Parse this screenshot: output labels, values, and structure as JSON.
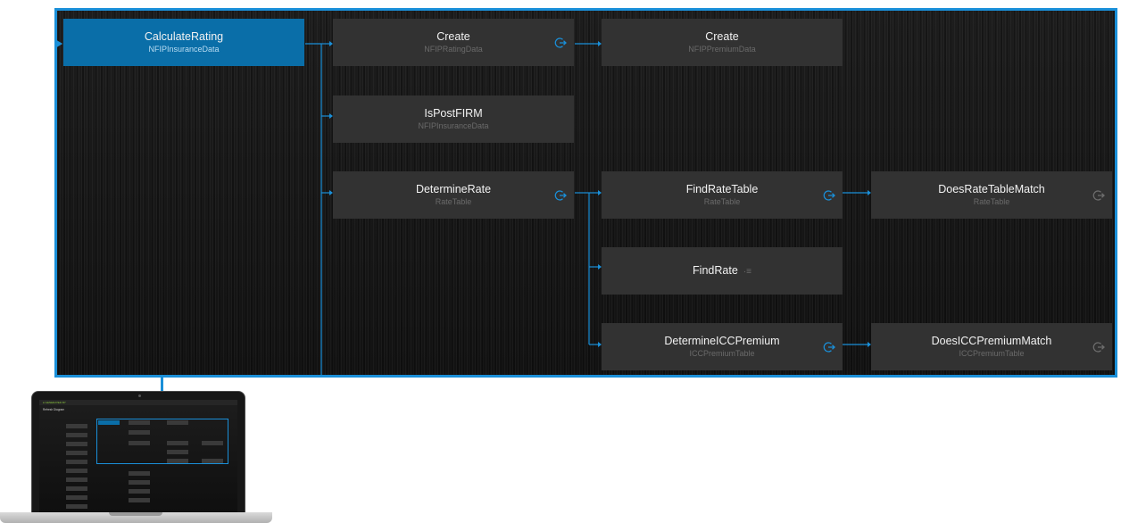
{
  "colors": {
    "accent": "#1a8fd8",
    "primary_node": "#0a6ea8",
    "node": "#323232",
    "panel_background": "#131313",
    "node_subtitle": "#6a6a6a",
    "brand_green": "#8cc63f"
  },
  "diagram": {
    "nodes": [
      {
        "id": "calculate-rating",
        "title": "CalculateRating",
        "subtitle": "NFIPInsuranceData",
        "primary": true
      },
      {
        "id": "create-rating",
        "title": "Create",
        "subtitle": "NFIPRatingData",
        "expand_icon": "enter-arrow-icon"
      },
      {
        "id": "create-premium",
        "title": "Create",
        "subtitle": "NFIPPremiumData"
      },
      {
        "id": "is-post-firm",
        "title": "IsPostFIRM",
        "subtitle": "NFIPInsuranceData"
      },
      {
        "id": "determine-rate",
        "title": "DetermineRate",
        "subtitle": "RateTable",
        "expand_icon": "enter-arrow-icon"
      },
      {
        "id": "find-rate-table",
        "title": "FindRateTable",
        "subtitle": "RateTable",
        "expand_icon": "enter-arrow-icon"
      },
      {
        "id": "does-rate-table-match",
        "title": "DoesRateTableMatch",
        "subtitle": "RateTable",
        "expand_icon": "enter-arrow-icon",
        "muted": true
      },
      {
        "id": "find-rate",
        "title": "FindRate",
        "subtitle": "",
        "list_icon": "list-icon"
      },
      {
        "id": "determine-icc-premium",
        "title": "DetermineICCPremium",
        "subtitle": "ICCPremiumTable",
        "expand_icon": "enter-arrow-icon"
      },
      {
        "id": "does-icc-premium-match",
        "title": "DoesICCPremiumMatch",
        "subtitle": "ICCPremiumTable",
        "expand_icon": "enter-arrow-icon",
        "muted": true
      }
    ],
    "edges": [
      [
        "calculate-rating",
        "create-rating"
      ],
      [
        "calculate-rating",
        "is-post-firm"
      ],
      [
        "calculate-rating",
        "determine-rate"
      ],
      [
        "create-rating",
        "create-premium"
      ],
      [
        "determine-rate",
        "find-rate-table"
      ],
      [
        "determine-rate",
        "find-rate"
      ],
      [
        "determine-rate",
        "determine-icc-premium"
      ],
      [
        "find-rate-table",
        "does-rate-table-match"
      ],
      [
        "determine-icc-premium",
        "does-icc-premium-match"
      ]
    ]
  },
  "thumbnail": {
    "brand": "● GENERATED BY",
    "heading": "Refresh Diagram"
  }
}
